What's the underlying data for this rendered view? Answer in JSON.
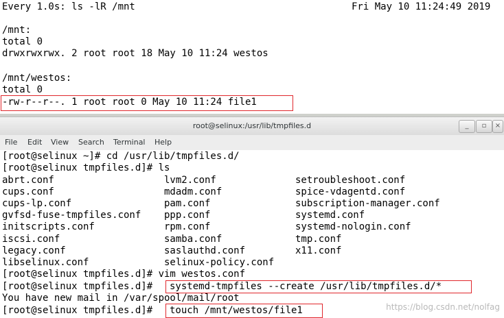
{
  "top_terminal": {
    "header_cmd": "Every 1.0s: ls -lR /mnt",
    "header_time": "Fri May 10 11:24:49 2019",
    "lines": [
      "",
      "/mnt:",
      "total 0",
      "drwxrwxrwx. 2 root root 18 May 10 11:24 westos",
      "",
      "/mnt/westos:",
      "total 0",
      "-rw-r--r--. 1 root root 0 May 10 11:24 file1"
    ]
  },
  "window": {
    "title": "root@selinux:/usr/lib/tmpfiles.d",
    "minimize_label": "_",
    "maximize_label": "▫",
    "close_label": "×"
  },
  "menu": {
    "file": "File",
    "edit": "Edit",
    "view": "View",
    "search": "Search",
    "terminal": "Terminal",
    "help": "Help"
  },
  "terminal": {
    "cmd1": "[root@selinux ~]# cd /usr/lib/tmpfiles.d/",
    "cmd2": "[root@selinux tmpfiles.d]# ls",
    "files_col1": [
      "abrt.conf",
      "cups.conf",
      "cups-lp.conf",
      "gvfsd-fuse-tmpfiles.conf",
      "initscripts.conf",
      "iscsi.conf",
      "legacy.conf",
      "libselinux.conf"
    ],
    "files_col2": [
      "lvm2.conf",
      "mdadm.conf",
      "pam.conf",
      "ppp.conf",
      "rpm.conf",
      "samba.conf",
      "saslauthd.conf",
      "selinux-policy.conf"
    ],
    "files_col3": [
      "setroubleshoot.conf",
      "spice-vdagentd.conf",
      "subscription-manager.conf",
      "systemd.conf",
      "systemd-nologin.conf",
      "tmp.conf",
      "x11.conf",
      ""
    ],
    "cmd3": "[root@selinux tmpfiles.d]# vim westos.conf",
    "prompt4": "[root@selinux tmpfiles.d]# ",
    "cmd4": "systemd-tmpfiles --create /usr/lib/tmpfiles.d/*",
    "mail": "You have new mail in /var/spool/mail/root",
    "prompt5": "[root@selinux tmpfiles.d]# ",
    "cmd5": "touch /mnt/westos/file1"
  },
  "watermark": "https://blog.csdn.net/nolfag",
  "colors": {
    "highlight": "#e0262b",
    "titlebar": "#dcdcdc",
    "text": "#000000"
  }
}
